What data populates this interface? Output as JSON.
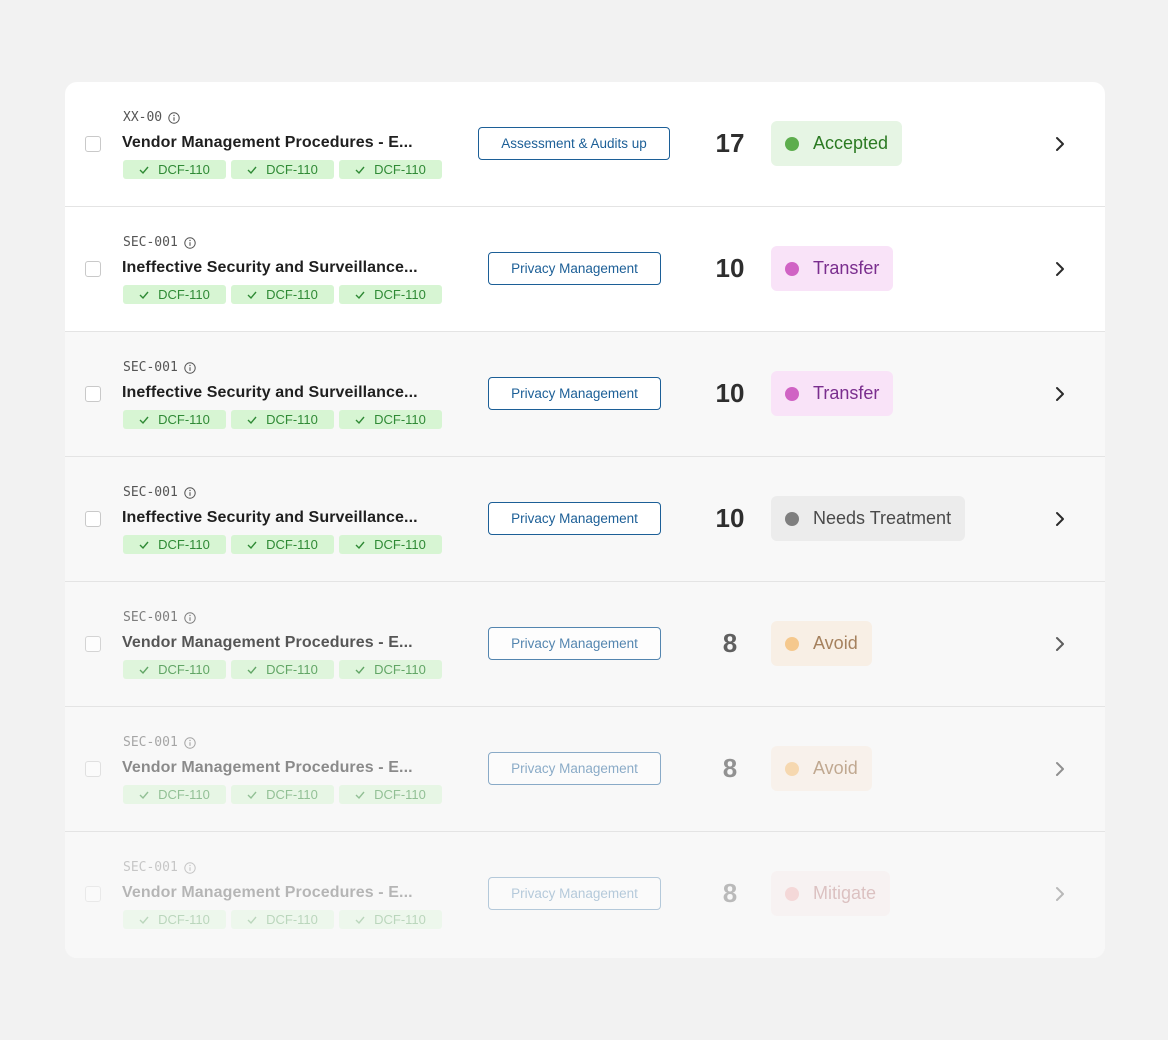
{
  "rows": [
    {
      "id": "XX-00",
      "title": "Vendor Management Procedures - E...",
      "chips": [
        "DCF-110",
        "DCF-110",
        "DCF-110"
      ],
      "category": "Assessment & Audits up",
      "score": "17",
      "status": "Accepted",
      "status_bg": "#e6f5e4",
      "status_fg": "#2b7a22",
      "dot": "#5dad4d"
    },
    {
      "id": "SEC-001",
      "title": "Ineffective Security and Surveillance...",
      "chips": [
        "DCF-110",
        "DCF-110",
        "DCF-110"
      ],
      "category": "Privacy Management",
      "score": "10",
      "status": "Transfer",
      "status_bg": "#f9e3f8",
      "status_fg": "#7a2e8e",
      "dot": "#d063c4"
    },
    {
      "id": "SEC-001",
      "title": "Ineffective Security and Surveillance...",
      "chips": [
        "DCF-110",
        "DCF-110",
        "DCF-110"
      ],
      "category": "Privacy Management",
      "score": "10",
      "status": "Transfer",
      "status_bg": "#f9e3f8",
      "status_fg": "#7a2e8e",
      "dot": "#d063c4"
    },
    {
      "id": "SEC-001",
      "title": "Ineffective Security and Surveillance...",
      "chips": [
        "DCF-110",
        "DCF-110",
        "DCF-110"
      ],
      "category": "Privacy Management",
      "score": "10",
      "status": "Needs Treatment",
      "status_bg": "#ececec",
      "status_fg": "#4a4a4a",
      "dot": "#7f7f7f"
    },
    {
      "id": "SEC-001",
      "title": "Vendor Management Procedures - E...",
      "chips": [
        "DCF-110",
        "DCF-110",
        "DCF-110"
      ],
      "category": "Privacy Management",
      "score": "8",
      "status": "Avoid",
      "status_bg": "#f8ecdf",
      "status_fg": "#8a5a2b",
      "dot": "#f5b96a"
    },
    {
      "id": "SEC-001",
      "title": "Vendor Management Procedures - E...",
      "chips": [
        "DCF-110",
        "DCF-110",
        "DCF-110"
      ],
      "category": "Privacy Management",
      "score": "8",
      "status": "Avoid",
      "status_bg": "#f8ecdf",
      "status_fg": "#8a5a2b",
      "dot": "#f5b96a"
    },
    {
      "id": "SEC-001",
      "title": "Vendor Management Procedures - E...",
      "chips": [
        "DCF-110",
        "DCF-110",
        "DCF-110"
      ],
      "category": "Privacy Management",
      "score": "8",
      "status": "Mitigate",
      "status_bg": "#f7e6e6",
      "status_fg": "#9c4545",
      "dot": "#ee8f8f"
    }
  ]
}
